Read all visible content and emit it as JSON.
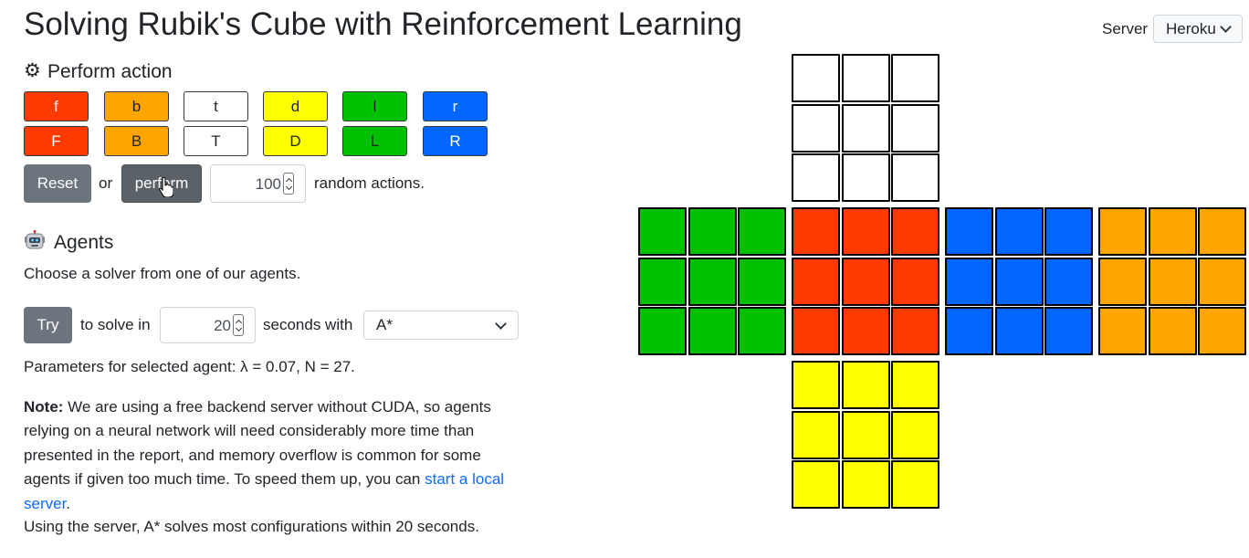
{
  "header": {
    "title": "Solving Rubik's Cube with Reinforcement Learning"
  },
  "server": {
    "label": "Server",
    "selected": "Heroku"
  },
  "perform": {
    "icon": "gear-icon",
    "gear_glyph": "⚙",
    "heading": "Perform action",
    "moves_row1": [
      {
        "label": "f",
        "color": "#ff3a00",
        "text": "#ffffff"
      },
      {
        "label": "b",
        "color": "#ffa500",
        "text": "#212529"
      },
      {
        "label": "t",
        "color": "#ffffff",
        "text": "#212529"
      },
      {
        "label": "d",
        "color": "#ffff00",
        "text": "#212529"
      },
      {
        "label": "l",
        "color": "#00c000",
        "text": "#212529"
      },
      {
        "label": "r",
        "color": "#0066ff",
        "text": "#ffffff"
      }
    ],
    "moves_row2": [
      {
        "label": "F",
        "color": "#ff3a00",
        "text": "#ffffff"
      },
      {
        "label": "B",
        "color": "#ffa500",
        "text": "#212529"
      },
      {
        "label": "T",
        "color": "#ffffff",
        "text": "#212529"
      },
      {
        "label": "D",
        "color": "#ffff00",
        "text": "#212529"
      },
      {
        "label": "L",
        "color": "#00c000",
        "text": "#212529"
      },
      {
        "label": "R",
        "color": "#0066ff",
        "text": "#ffffff"
      }
    ],
    "reset_label": "Reset",
    "or_text": "or",
    "perform_label": "perform",
    "count_value": "100",
    "suffix": "random actions."
  },
  "agents": {
    "icon": "robot-icon",
    "heading": "Agents",
    "subtitle": "Choose a solver from one of our agents.",
    "try_label": "Try",
    "to_solve_text": "to solve in",
    "seconds_value": "20",
    "seconds_text": "seconds with",
    "selected_agent": "A*",
    "params": "Parameters for selected agent: λ = 0.07, N = 27."
  },
  "note": {
    "bold": "Note:",
    "text": " We are using a free backend server without CUDA, so agents relying on a neural network will need considerably more time than presented in the report, and memory overflow is common for some agents if given too much time. To speed them up, you can ",
    "link": "start a local server",
    "end": ".",
    "line2": "Using the server, A* solves most configurations within 20 seconds."
  },
  "cube": {
    "colors": {
      "white": "#ffffff",
      "green": "#00c000",
      "red": "#ff3a00",
      "blue": "#0066ff",
      "orange": "#ffa500",
      "yellow": "#ffff00"
    },
    "faces": [
      {
        "name": "top",
        "color": "white"
      },
      {
        "name": "left",
        "color": "green"
      },
      {
        "name": "front",
        "color": "red"
      },
      {
        "name": "right",
        "color": "blue"
      },
      {
        "name": "back",
        "color": "orange"
      },
      {
        "name": "bottom",
        "color": "yellow"
      }
    ]
  }
}
